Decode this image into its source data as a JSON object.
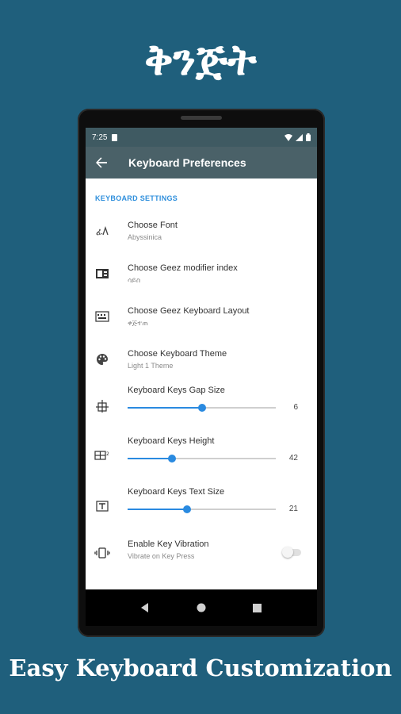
{
  "promo": {
    "headline": "ቅንጅት",
    "caption": "Easy Keyboard Customization"
  },
  "colors": {
    "background": "#1f5f7c",
    "statusbar": "#3f5a62",
    "toolbar": "#4a6168",
    "accent": "#2a8ae0"
  },
  "statusbar": {
    "time": "7:25",
    "icons": [
      "sd-card-icon",
      "wifi-icon",
      "signal-icon",
      "battery-icon"
    ]
  },
  "toolbar": {
    "back_icon": "arrow-back-icon",
    "title": "Keyboard Preferences"
  },
  "section": {
    "header": "KEYBOARD SETTINGS"
  },
  "prefs": {
    "font": {
      "title": "Choose Font",
      "summary": "Abyssinica",
      "icon": "font-icon"
    },
    "modifier": {
      "title": "Choose Geez modifier index",
      "summary": "ሳይስ",
      "icon": "modifier-index-icon"
    },
    "layout": {
      "title": "Choose Geez Keyboard Layout",
      "summary": "ቀጅተጠ",
      "icon": "keyboard-layout-icon"
    },
    "theme": {
      "title": "Choose Keyboard Theme",
      "summary": "Light 1 Theme",
      "icon": "palette-icon"
    },
    "gap": {
      "title": "Keyboard Keys Gap Size",
      "value": "6",
      "fraction": 0.5,
      "icon": "key-gap-icon"
    },
    "height": {
      "title": "Keyboard Keys Height",
      "value": "42",
      "fraction": 0.3,
      "icon": "key-height-icon"
    },
    "textsize": {
      "title": "Keyboard Keys Text Size",
      "value": "21",
      "fraction": 0.4,
      "icon": "key-text-size-icon"
    },
    "vibration": {
      "title": "Enable Key Vibration",
      "summary": "Vibrate on Key Press",
      "enabled": false,
      "icon": "vibration-icon"
    }
  },
  "navbar": {
    "back": "nav-back-icon",
    "home": "nav-home-icon",
    "recents": "nav-recents-icon"
  }
}
